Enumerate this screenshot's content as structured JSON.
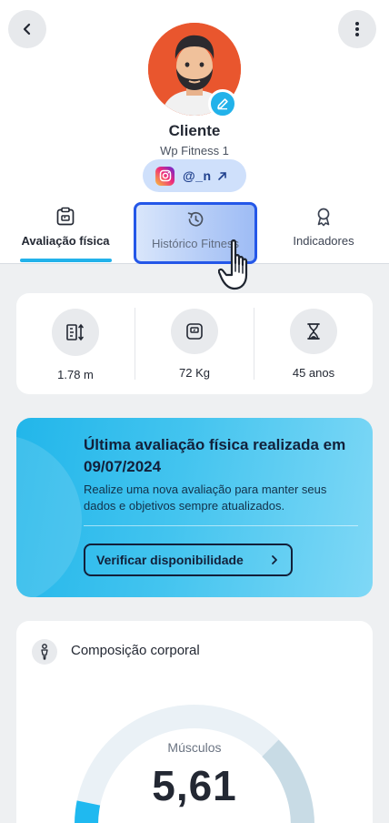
{
  "header": {
    "back_icon": "chevron-left-icon",
    "menu_icon": "more-vertical-icon",
    "client_name": "Cliente",
    "company": "Wp Fitness 1",
    "instagram_handle": "@_n",
    "instagram_icon": "instagram-icon",
    "external_icon": "arrow-up-right-icon"
  },
  "tabs": [
    {
      "label": "Avaliação física",
      "icon": "scale-clipboard-icon",
      "active": true
    },
    {
      "label": "Histórico Fitness",
      "icon": "history-icon",
      "active": false
    },
    {
      "label": "Indicadores",
      "icon": "award-icon",
      "active": false
    }
  ],
  "stats": [
    {
      "value": "1.78 m",
      "icon": "height-icon"
    },
    {
      "value": "72 Kg",
      "icon": "weight-scale-icon"
    },
    {
      "value": "45 anos",
      "icon": "hourglass-icon"
    }
  ],
  "promo": {
    "title": "Última avaliação física realizada em  09/07/2024",
    "text": "Realize uma nova avaliação para manter seus dados e objetivos sempre atualizados.",
    "button_label": "Verificar disponibilidade"
  },
  "composition": {
    "title": "Composição corporal",
    "gauge_label": "Músculos",
    "gauge_value": "5,61"
  },
  "colors": {
    "accent": "#22b2ea",
    "highlight_border": "#2457e8",
    "avatar_bg": "#e9562e"
  }
}
